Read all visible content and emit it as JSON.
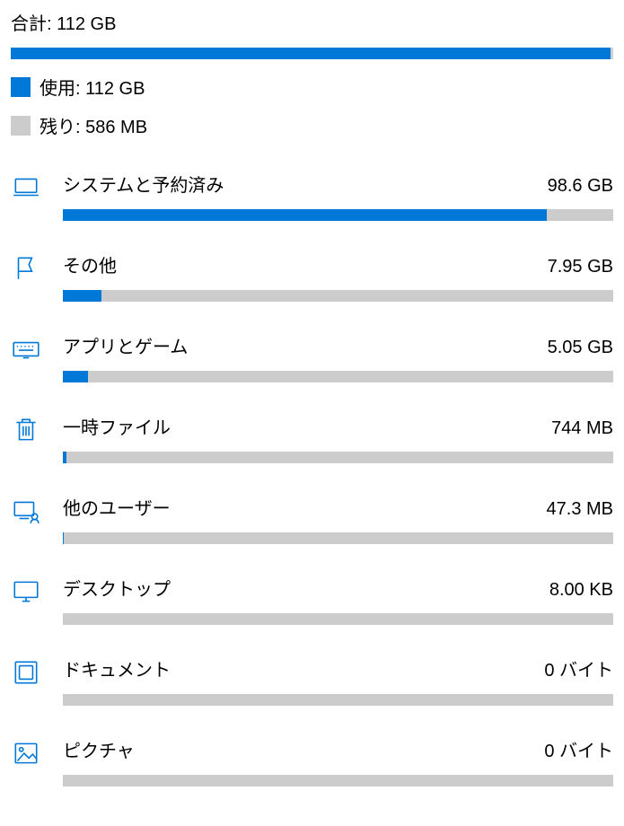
{
  "summary": {
    "total_label": "合計: 112 GB",
    "used_label": "使用: 112 GB",
    "free_label": "残り: 586 MB",
    "used_percent": 99.5
  },
  "categories": [
    {
      "icon": "laptop-icon",
      "label": "システムと予約済み",
      "size": "98.6 GB",
      "percent": 88
    },
    {
      "icon": "flag-icon",
      "label": "その他",
      "size": "7.95 GB",
      "percent": 7
    },
    {
      "icon": "keyboard-icon",
      "label": "アプリとゲーム",
      "size": "5.05 GB",
      "percent": 4.5
    },
    {
      "icon": "trash-icon",
      "label": "一時ファイル",
      "size": "744 MB",
      "percent": 0.7
    },
    {
      "icon": "users-icon",
      "label": "他のユーザー",
      "size": "47.3 MB",
      "percent": 0.05
    },
    {
      "icon": "monitor-icon",
      "label": "デスクトップ",
      "size": "8.00 KB",
      "percent": 0
    },
    {
      "icon": "document-icon",
      "label": "ドキュメント",
      "size": "0 バイト",
      "percent": 0
    },
    {
      "icon": "picture-icon",
      "label": "ピクチャ",
      "size": "0 バイト",
      "percent": 0
    }
  ]
}
